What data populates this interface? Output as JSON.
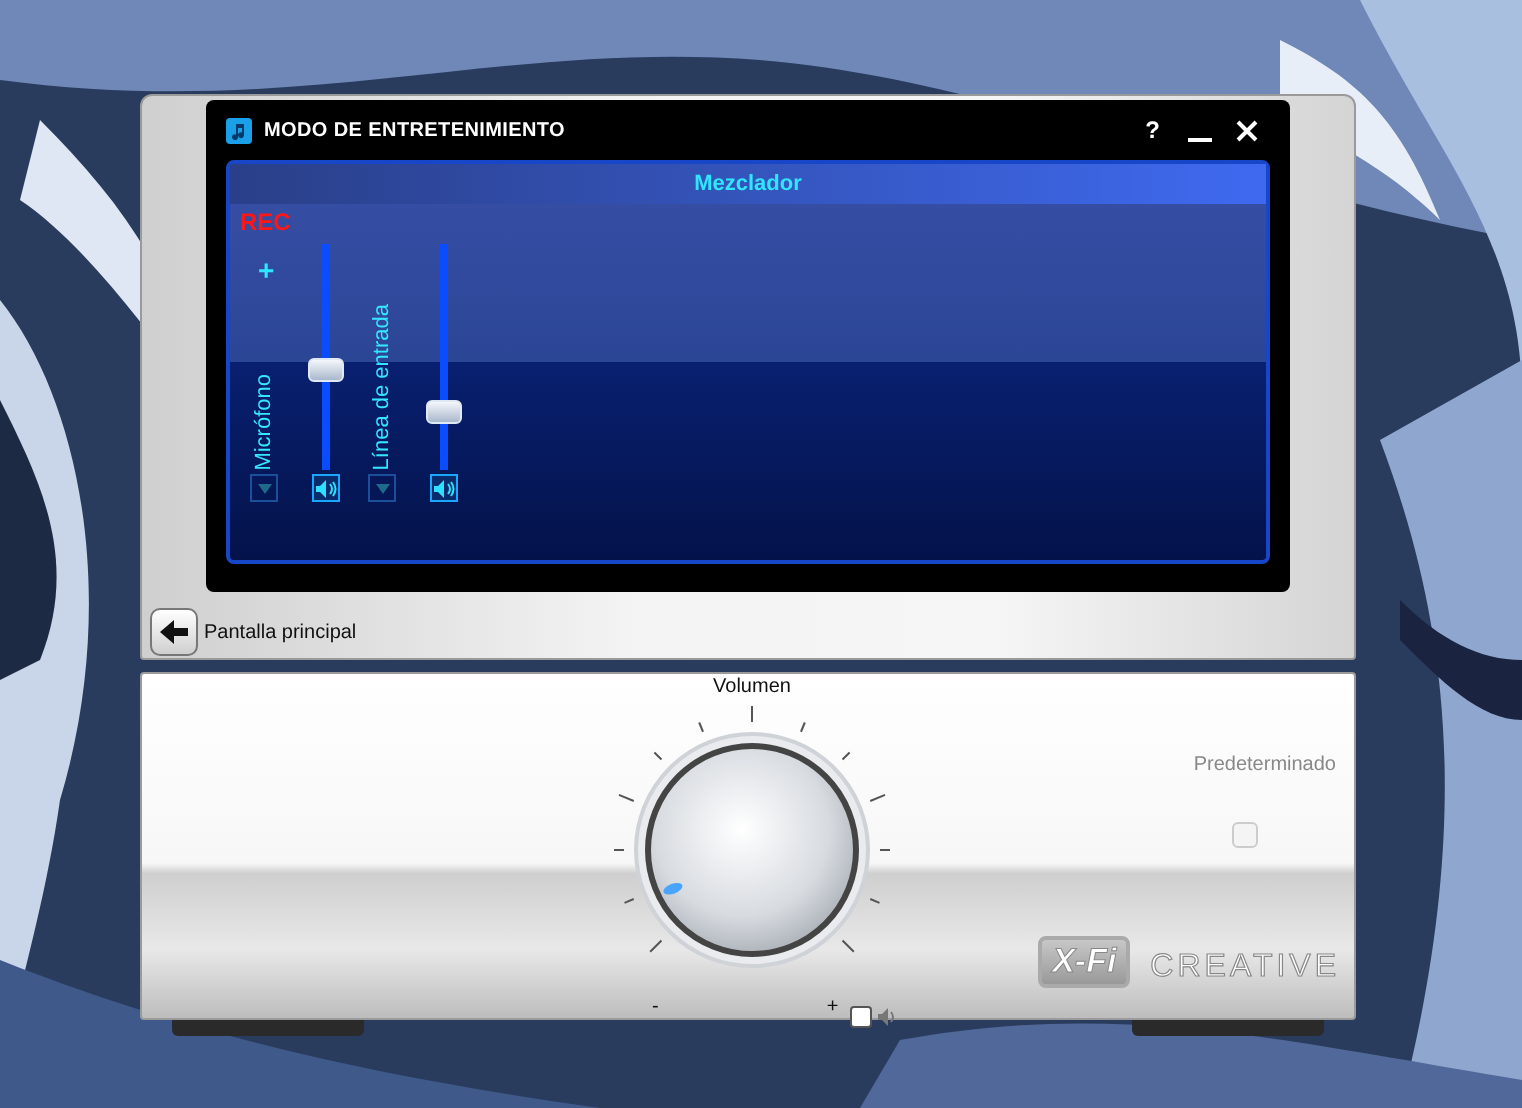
{
  "window": {
    "title": "MODO DE ENTRETENIMIENTO",
    "help": "?"
  },
  "mixer": {
    "title": "Mezclador",
    "rec_label": "REC",
    "gain_label": "+",
    "channels": [
      {
        "name": "Micrófono",
        "level": 0.49,
        "muted": false
      },
      {
        "name": "Línea de entrada",
        "level": 0.28,
        "muted": false
      }
    ]
  },
  "back_button": {
    "label": "Pantalla principal"
  },
  "volume": {
    "label": "Volumen",
    "level": 0.07,
    "min_label": "-",
    "max_label": "+",
    "lock": {
      "checked": false
    }
  },
  "default": {
    "label": "Predeterminado",
    "checked": false
  },
  "logos": {
    "xfi": "X-Fi",
    "brand": "CREATIVE"
  }
}
